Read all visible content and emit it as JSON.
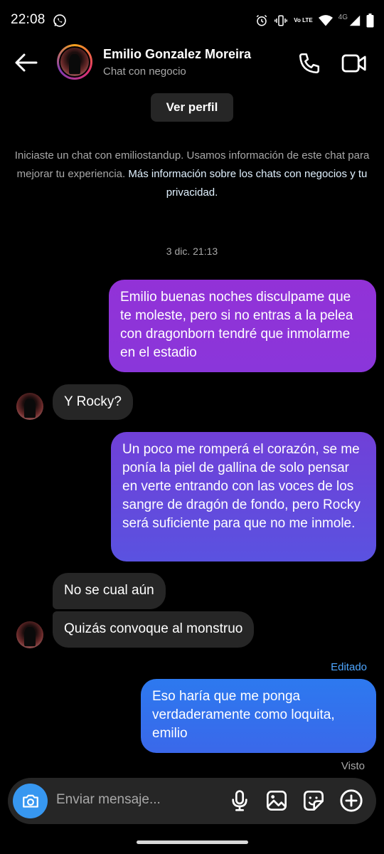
{
  "status_bar": {
    "time": "22:08",
    "network": "4G",
    "volte": "Vo LTE",
    "icons": [
      "whatsapp-icon",
      "alarm-icon",
      "vibrate-icon",
      "volte-icon",
      "wifi-icon",
      "signal-icon",
      "battery-icon"
    ]
  },
  "header": {
    "name": "Emilio Gonzalez Moreira",
    "subtitle": "Chat con negocio",
    "icons": [
      "back-arrow-icon",
      "phone-icon",
      "video-camera-icon"
    ]
  },
  "view_profile_label": "Ver perfil",
  "intro": {
    "text": "Iniciaste un chat con emiliostandup. Usamos información de este chat para mejorar tu experiencia.",
    "link": "Más información sobre los chats con negocios y tu privacidad."
  },
  "timestamp": "3 dic. 21:13",
  "messages": [
    {
      "sender": "me",
      "text": "Emilio buenas noches disculpame que te moleste, pero si no entras a la pelea con dragonborn tendré que inmolarme en el estadio"
    },
    {
      "sender": "them",
      "text": "Y Rocky?"
    },
    {
      "sender": "me",
      "text": "Un poco me romperá el corazón, se me ponía la piel de gallina de solo pensar en verte entrando con las voces de los sangre de dragón de fondo, pero Rocky será suficiente para que no me inmole."
    },
    {
      "sender": "them",
      "text": "No se cual aún"
    },
    {
      "sender": "them",
      "text": "Quizás convoque al monstruo"
    },
    {
      "sender": "me",
      "text": "Eso haría que me ponga verdaderamente como loquita, emilio"
    }
  ],
  "edited_label": "Editado",
  "seen_label": "Visto",
  "composer": {
    "placeholder": "Enviar mensaje...",
    "icons": [
      "camera-icon",
      "microphone-icon",
      "gallery-icon",
      "sticker-icon",
      "plus-icon"
    ]
  },
  "colors": {
    "background": "#000000",
    "incoming_bubble": "#262626",
    "outgoing_purple": "#8a36da",
    "outgoing_indigo": "#5a52e0",
    "outgoing_blue": "#3a68ea",
    "accent": "#3797f0"
  }
}
